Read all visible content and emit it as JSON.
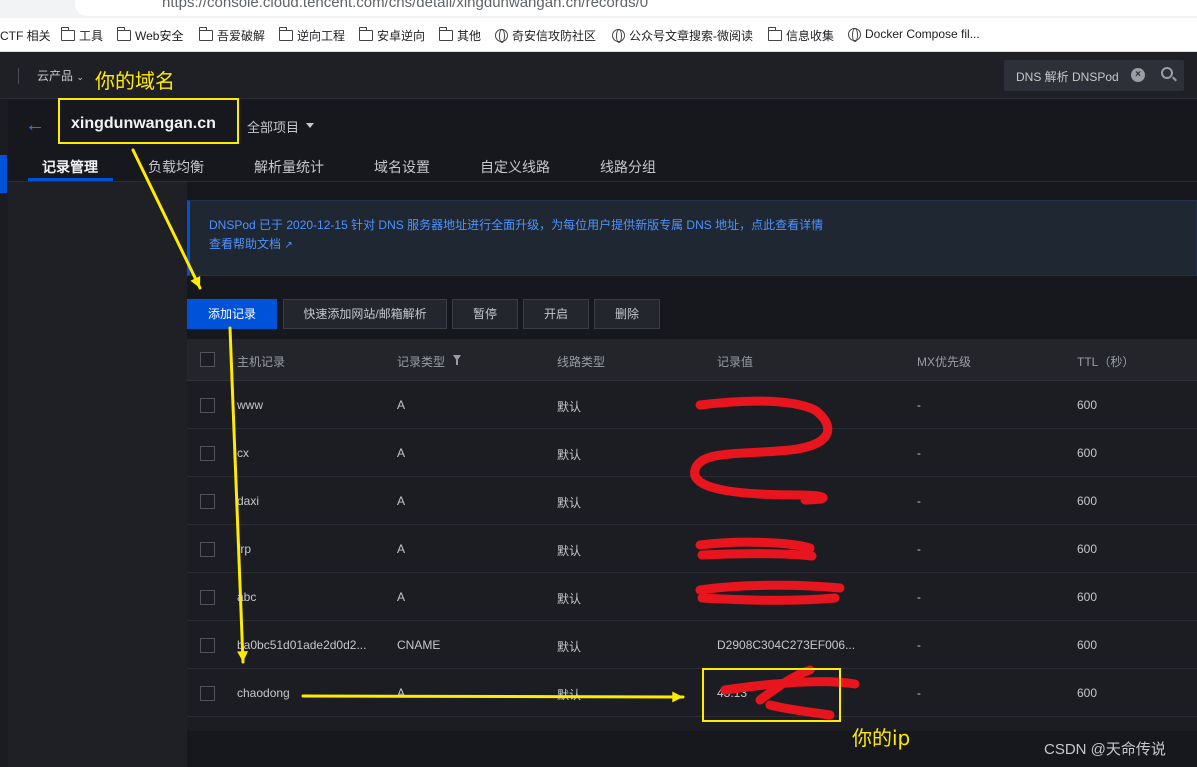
{
  "browser": {
    "url": "https://console.cloud.tencent.com/cns/detail/xingdunwangan.cn/records/0",
    "bookmarks": [
      "CTF 相关",
      "工具",
      "Web安全",
      "吾爱破解",
      "逆向工程",
      "安卓逆向",
      "其他",
      "奇安信攻防社区",
      "公众号文章搜索-微阅读",
      "信息收集",
      "Docker Compose fil..."
    ]
  },
  "topnav": {
    "products_label": "云产品",
    "search_text": "DNS 解析 DNSPod"
  },
  "header": {
    "domain": "xingdunwangan.cn",
    "project_filter": "全部项目"
  },
  "tabs": [
    "记录管理",
    "负载均衡",
    "解析量统计",
    "域名设置",
    "自定义线路",
    "线路分组"
  ],
  "notice": {
    "line1": "DNSPod 已于 2020-12-15 针对 DNS 服务器地址进行全面升级，为每位用户提供新版专属 DNS 地址，点此查看详情",
    "line2": "查看帮助文档"
  },
  "toolbar": {
    "add": "添加记录",
    "quick_add": "快速添加网站/邮箱解析",
    "pause": "暂停",
    "enable": "开启",
    "delete": "删除"
  },
  "table": {
    "columns": [
      "主机记录",
      "记录类型",
      "线路类型",
      "记录值",
      "MX优先级",
      "TTL（秒）"
    ],
    "rows": [
      {
        "host": "www",
        "type": "A",
        "line": "默认",
        "value": "",
        "mx": "-",
        "ttl": "600"
      },
      {
        "host": "cx",
        "type": "A",
        "line": "默认",
        "value": "",
        "mx": "-",
        "ttl": "600"
      },
      {
        "host": "daxi",
        "type": "A",
        "line": "默认",
        "value": "",
        "mx": "-",
        "ttl": "600"
      },
      {
        "host": "frp",
        "type": "A",
        "line": "默认",
        "value": "",
        "mx": "-",
        "ttl": "600"
      },
      {
        "host": "abc",
        "type": "A",
        "line": "默认",
        "value": "",
        "mx": "-",
        "ttl": "600"
      },
      {
        "host": "ba0bc51d01ade2d0d2...",
        "type": "CNAME",
        "line": "默认",
        "value": "D2908C304C273EF006...",
        "mx": "-",
        "ttl": "600"
      },
      {
        "host": "chaodong",
        "type": "A",
        "line": "默认",
        "value": "43.13",
        "mx": "-",
        "ttl": "600"
      }
    ]
  },
  "annotations": {
    "domain_label": "你的域名",
    "ip_label": "你的ip",
    "color": "#ffeb00",
    "redaction_color": "#e8151f"
  },
  "watermark": "CSDN @天命传说"
}
